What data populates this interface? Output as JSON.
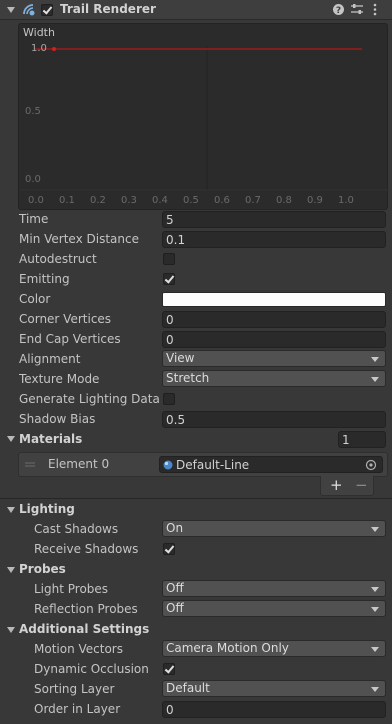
{
  "component": {
    "title": "Trail Renderer",
    "enabled": true
  },
  "width_curve": {
    "label": "Width",
    "y_ticks": [
      "1.0",
      "0.5",
      "0.0"
    ],
    "x_ticks": [
      "0.0",
      "0.1",
      "0.2",
      "0.3",
      "0.4",
      "0.5",
      "0.6",
      "0.7",
      "0.8",
      "0.9",
      "1.0"
    ],
    "value": 1.0,
    "curve_color": "#9e1b1b"
  },
  "properties": {
    "time": {
      "label": "Time",
      "value": "5"
    },
    "min_vertex_distance": {
      "label": "Min Vertex Distance",
      "value": "0.1"
    },
    "autodestruct": {
      "label": "Autodestruct",
      "checked": false
    },
    "emitting": {
      "label": "Emitting",
      "checked": true
    },
    "color": {
      "label": "Color",
      "value": "#ffffff"
    },
    "corner_vertices": {
      "label": "Corner Vertices",
      "value": "0"
    },
    "end_cap_vertices": {
      "label": "End Cap Vertices",
      "value": "0"
    },
    "alignment": {
      "label": "Alignment",
      "value": "View"
    },
    "texture_mode": {
      "label": "Texture Mode",
      "value": "Stretch"
    },
    "generate_lighting_data": {
      "label": "Generate Lighting Data",
      "checked": false
    },
    "shadow_bias": {
      "label": "Shadow Bias",
      "value": "0.5"
    }
  },
  "materials": {
    "label": "Materials",
    "count": "1",
    "element_label": "Element 0",
    "element_value": "Default-Line",
    "add": "+",
    "remove": "−"
  },
  "lighting": {
    "title": "Lighting",
    "cast_shadows": {
      "label": "Cast Shadows",
      "value": "On"
    },
    "receive_shadows": {
      "label": "Receive Shadows",
      "checked": true
    }
  },
  "probes": {
    "title": "Probes",
    "light_probes": {
      "label": "Light Probes",
      "value": "Off"
    },
    "reflection_probes": {
      "label": "Reflection Probes",
      "value": "Off"
    }
  },
  "additional": {
    "title": "Additional Settings",
    "motion_vectors": {
      "label": "Motion Vectors",
      "value": "Camera Motion Only"
    },
    "dynamic_occlusion": {
      "label": "Dynamic Occlusion",
      "checked": true
    },
    "sorting_layer": {
      "label": "Sorting Layer",
      "value": "Default"
    },
    "order_in_layer": {
      "label": "Order in Layer",
      "value": "0"
    }
  },
  "icons": {
    "component": "trail-renderer-icon",
    "help": "help-icon",
    "presets": "presets-icon",
    "menu": "kebab-menu-icon",
    "object_picker": "object-picker-icon",
    "material": "material-sphere-icon"
  }
}
